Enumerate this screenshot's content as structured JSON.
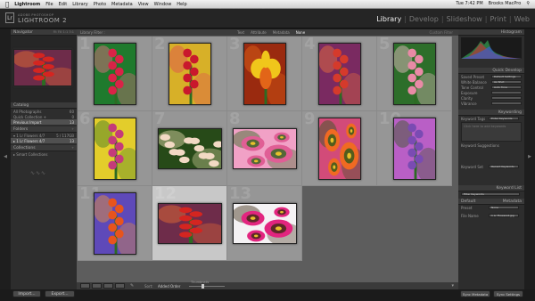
{
  "menubar": {
    "app": "Lightroom",
    "items": [
      "File",
      "Edit",
      "Library",
      "Photo",
      "Metadata",
      "View",
      "Window",
      "Help"
    ],
    "window_title": "Fotografie lrcat - Adobe Photoshop Lightroom - Library",
    "clock": "Tue 7:42 PM",
    "user": "Brooks MacPro"
  },
  "header": {
    "logo_lr": "Lr",
    "logo_sub": "ADOBE PHOTOSHOP",
    "logo_main": "LIGHTROOM 2",
    "modules": [
      "Library",
      "Develop",
      "Slideshow",
      "Print",
      "Web"
    ],
    "active_module": "Library"
  },
  "left": {
    "navigator": "Navigator",
    "navigator_opts": "Fit  Fill  1:1  3:1",
    "catalog": "Catalog",
    "catalog_items": [
      {
        "label": "All Photographs",
        "count": "60"
      },
      {
        "label": "Quick Collection +",
        "count": "0"
      },
      {
        "label": "Previous Import",
        "count": "13"
      }
    ],
    "folders": "Folders",
    "folder_items": [
      {
        "label": "▾ 1 Lr Flowers 4/7",
        "count": "5 / 117GB"
      },
      {
        "label": "  ▸ 1 Lr Flowers 4/7",
        "count": "13"
      }
    ],
    "collections": "Collections",
    "collection_items": [
      {
        "label": "▸ Smart Collections",
        "count": ""
      }
    ],
    "import_btn": "Import...",
    "export_btn": "Export..."
  },
  "filter": {
    "label": "Library Filter :",
    "tabs": [
      "Text",
      "Attribute",
      "Metadata",
      "None"
    ],
    "active": "None",
    "custom": "Custom Filter"
  },
  "grid": {
    "cells": [
      {
        "num": "1",
        "colors": [
          "#d92347",
          "#1f7a2d",
          "#f06a8a"
        ],
        "kind": "snap",
        "shape": "portrait"
      },
      {
        "num": "2",
        "colors": [
          "#c9182d",
          "#d7b028",
          "#e04b53"
        ],
        "kind": "snap",
        "shape": "portrait"
      },
      {
        "num": "3",
        "colors": [
          "#f0c61b",
          "#9a2a0f",
          "#e26518"
        ],
        "kind": "iris",
        "shape": "portrait"
      },
      {
        "num": "4",
        "colors": [
          "#d53a2b",
          "#7a2a61",
          "#f0743a"
        ],
        "kind": "snap",
        "shape": "portrait"
      },
      {
        "num": "5",
        "colors": [
          "#e98aa6",
          "#2d6e2a",
          "#f6c0cf"
        ],
        "kind": "snap",
        "shape": "portrait"
      },
      {
        "num": "6",
        "colors": [
          "#c43b7a",
          "#e3cd2b",
          "#3a7a2a"
        ],
        "kind": "snap",
        "shape": "portrait"
      },
      {
        "num": "7",
        "colors": [
          "#f2d9c4",
          "#274a18",
          "#e9e1b0"
        ],
        "kind": "spray",
        "shape": "landscape"
      },
      {
        "num": "8",
        "colors": [
          "#e05e95",
          "#f1a1c6",
          "#2f6a20"
        ],
        "kind": "daisy",
        "shape": "landscape"
      },
      {
        "num": "9",
        "colors": [
          "#f06a22",
          "#d24b79",
          "#2c5a1c"
        ],
        "kind": "daisy",
        "shape": "portrait"
      },
      {
        "num": "10",
        "colors": [
          "#7a4bb3",
          "#b95fc6",
          "#355a22"
        ],
        "kind": "snap",
        "shape": "portrait"
      },
      {
        "num": "11",
        "colors": [
          "#e7541d",
          "#5e49b9",
          "#f09a33"
        ],
        "kind": "snap",
        "shape": "portrait"
      },
      {
        "num": "12",
        "colors": [
          "#d42520",
          "#6e2c4a",
          "#f07030"
        ],
        "kind": "snap",
        "shape": "landscape"
      },
      {
        "num": "13",
        "colors": [
          "#e2257f",
          "#f4f2f4",
          "#3b2a12"
        ],
        "kind": "daisy",
        "shape": "landscape"
      }
    ],
    "selected": "12"
  },
  "toolbar": {
    "sort_label": "Sort:",
    "sort_value": "Added Order",
    "thumbnails": "Thumbnails"
  },
  "right": {
    "histogram": "Histogram",
    "quick_develop": "Quick Develop",
    "qd_rows": [
      {
        "label": "Saved Preset",
        "value": "Default Settings"
      },
      {
        "label": "White Balance",
        "value": "As Shot"
      },
      {
        "label": "Tone Control",
        "value": "Auto Tone"
      },
      {
        "label": "Exposure",
        "value": ""
      },
      {
        "label": "Clarity",
        "value": ""
      },
      {
        "label": "Vibrance",
        "value": ""
      }
    ],
    "keywording": "Keywording",
    "keyword_tags": "Keyword Tags",
    "keyword_tags_val": "Enter Keywords",
    "keyword_hint": "Click here to add keywords",
    "keyword_suggestions": "Keyword Suggestions",
    "keyword_set": "Keyword Set",
    "keyword_set_val": "Recent Keywords",
    "keyword_list": "Keyword List",
    "filter_keywords": "Filter Keywords",
    "metadata": "Metadata",
    "default": "Default",
    "preset_label": "Preset",
    "preset_val": "None",
    "file_name_label": "File Name",
    "file_name_val": "1 Lr Flowers4.jpg",
    "sync_metadata": "Sync Metadata",
    "sync_settings": "Sync Settings"
  }
}
